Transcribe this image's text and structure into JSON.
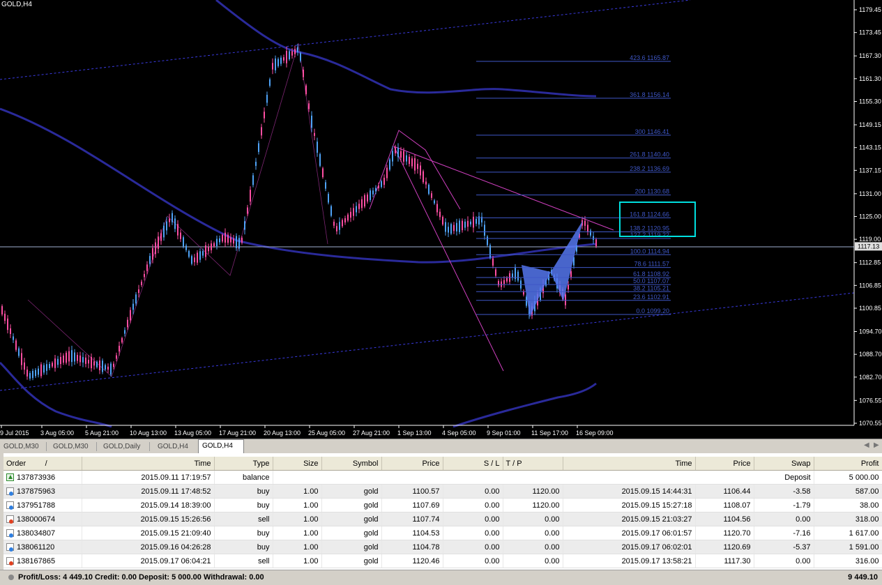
{
  "chart": {
    "symbol_label": "GOLD,H4",
    "colors": {
      "bull": "#4fa3f7",
      "bear": "#ff4fa3",
      "ma": "#2a2a9a",
      "fib": "#3f58c8",
      "trend_pink": "#d040c0",
      "channel": "#3a3adf",
      "highlight": "#00e0e0",
      "pattern": "#5577ee",
      "axis_text": "#ffffff",
      "price_label_bg": "#e0e0e0"
    },
    "price_scale": [
      "1179.45",
      "1173.45",
      "1167.30",
      "1161.30",
      "1155.30",
      "1149.15",
      "1143.15",
      "1137.15",
      "1131.00",
      "1125.00",
      "1119.00",
      "1112.85",
      "1106.85",
      "1100.85",
      "1094.70",
      "1088.70",
      "1082.70",
      "1076.55",
      "1070.55"
    ],
    "current_price": "1117.13",
    "time_scale": [
      "9 Jul 2015",
      "3 Aug 05:00",
      "5 Aug 21:00",
      "10 Aug 13:00",
      "13 Aug 05:00",
      "17 Aug 21:00",
      "20 Aug 13:00",
      "25 Aug 05:00",
      "27 Aug 21:00",
      "1 Sep 13:00",
      "4 Sep 05:00",
      "9 Sep 01:00",
      "11 Sep 17:00",
      "16 Sep 09:00"
    ],
    "fib_levels": [
      {
        "label": "423.6 1165.87",
        "price": 1165.87
      },
      {
        "label": "361.8 1156.14",
        "price": 1156.14
      },
      {
        "label": "300 1146.41",
        "price": 1146.41
      },
      {
        "label": "261.8 1140.40",
        "price": 1140.4
      },
      {
        "label": "238.2 1136.69",
        "price": 1136.69
      },
      {
        "label": "200 1130.68",
        "price": 1130.68
      },
      {
        "label": "161.8 1124.66",
        "price": 1124.66
      },
      {
        "label": "138.2 1120.95",
        "price": 1120.95
      },
      {
        "label": "127.2 1119.22",
        "price": 1119.22
      },
      {
        "label": "100.0 1114.94",
        "price": 1114.94
      },
      {
        "label": "78.6 1111.57",
        "price": 1111.57
      },
      {
        "label": "61.8 1108.92",
        "price": 1108.92
      },
      {
        "label": "50.0 1107.07",
        "price": 1107.07
      },
      {
        "label": "38.2 1105.21",
        "price": 1105.21
      },
      {
        "label": "23.6 1102.91",
        "price": 1102.91
      },
      {
        "label": "0.0 1099.20",
        "price": 1099.2
      }
    ]
  },
  "tabs": [
    {
      "label": "GOLD,M30",
      "active": false
    },
    {
      "label": "GOLD,M30",
      "active": false
    },
    {
      "label": "GOLD,Daily",
      "active": false
    },
    {
      "label": "GOLD,H4",
      "active": false
    },
    {
      "label": "GOLD,H4",
      "active": true
    }
  ],
  "terminal": {
    "headers": {
      "order": "Order",
      "sort_mark": "/",
      "time": "Time",
      "type": "Type",
      "size": "Size",
      "symbol": "Symbol",
      "price": "Price",
      "sl": "S / L",
      "tp": "T / P",
      "close_time": "Time",
      "close_price": "Price",
      "swap": "Swap",
      "profit": "Profit"
    },
    "deposit_row": {
      "order": "137873936",
      "time": "2015.09.11 17:19:57",
      "type": "balance",
      "comment": "Deposit",
      "profit": "5 000.00"
    },
    "rows": [
      {
        "order": "137875963",
        "time": "2015.09.11 17:48:52",
        "type": "buy",
        "size": "1.00",
        "symbol": "gold",
        "price": "1100.57",
        "sl": "0.00",
        "tp": "1120.00",
        "close_time": "2015.09.15 14:44:31",
        "close_price": "1106.44",
        "swap": "-3.58",
        "profit": "587.00",
        "icon": "buy"
      },
      {
        "order": "137951788",
        "time": "2015.09.14 18:39:00",
        "type": "buy",
        "size": "1.00",
        "symbol": "gold",
        "price": "1107.69",
        "sl": "0.00",
        "tp": "1120.00",
        "close_time": "2015.09.15 15:27:18",
        "close_price": "1108.07",
        "swap": "-1.79",
        "profit": "38.00",
        "icon": "buy"
      },
      {
        "order": "138000674",
        "time": "2015.09.15 15:26:56",
        "type": "sell",
        "size": "1.00",
        "symbol": "gold",
        "price": "1107.74",
        "sl": "0.00",
        "tp": "0.00",
        "close_time": "2015.09.15 21:03:27",
        "close_price": "1104.56",
        "swap": "0.00",
        "profit": "318.00",
        "icon": "sell"
      },
      {
        "order": "138034807",
        "time": "2015.09.15 21:09:40",
        "type": "buy",
        "size": "1.00",
        "symbol": "gold",
        "price": "1104.53",
        "sl": "0.00",
        "tp": "0.00",
        "close_time": "2015.09.17 06:01:57",
        "close_price": "1120.70",
        "swap": "-7.16",
        "profit": "1 617.00",
        "icon": "buy"
      },
      {
        "order": "138061120",
        "time": "2015.09.16 04:26:28",
        "type": "buy",
        "size": "1.00",
        "symbol": "gold",
        "price": "1104.78",
        "sl": "0.00",
        "tp": "0.00",
        "close_time": "2015.09.17 06:02:01",
        "close_price": "1120.69",
        "swap": "-5.37",
        "profit": "1 591.00",
        "icon": "buy"
      },
      {
        "order": "138167865",
        "time": "2015.09.17 06:04:21",
        "type": "sell",
        "size": "1.00",
        "symbol": "gold",
        "price": "1120.46",
        "sl": "0.00",
        "tp": "0.00",
        "close_time": "2015.09.17 13:58:21",
        "close_price": "1117.30",
        "swap": "0.00",
        "profit": "316.00",
        "icon": "sell"
      }
    ],
    "summary": {
      "text": "Profit/Loss: 4 449.10  Credit: 0.00  Deposit: 5 000.00  Withdrawal: 0.00",
      "total": "9 449.10"
    }
  }
}
